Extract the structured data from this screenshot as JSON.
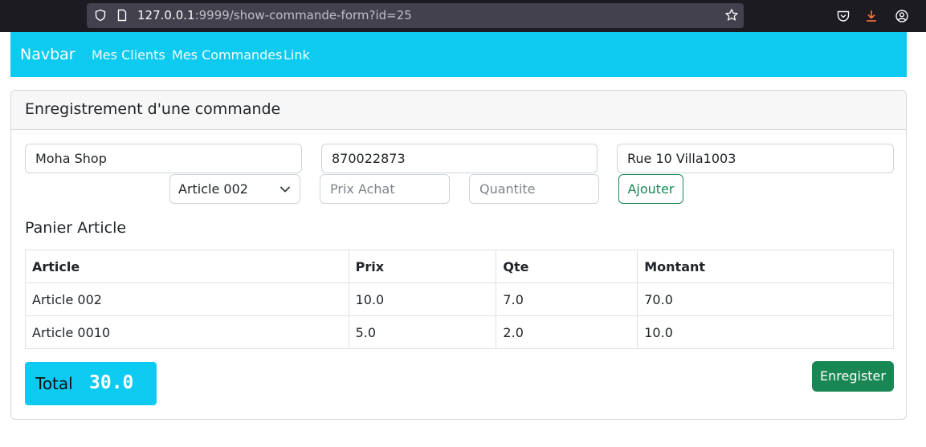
{
  "browser": {
    "url_host": "127.0.0.1",
    "url_rest": ":9999/show-commande-form?id=25",
    "icons": [
      "shield-icon",
      "page-icon",
      "star-icon",
      "pocket-icon",
      "download-icon",
      "account-icon"
    ],
    "download_color": "#ff7139"
  },
  "navbar": {
    "brand": "Navbar",
    "links": [
      "Mes Clients",
      "Mes Commandes",
      "Link"
    ],
    "color": "#0dcaf0"
  },
  "card": {
    "title": "Enregistrement d'une commande",
    "client_name": "Moha Shop",
    "client_phone": "870022873",
    "client_address": "Rue 10 Villa1003",
    "article_select": "Article 002",
    "prix_placeholder": "Prix Achat",
    "quantite_placeholder": "Quantite",
    "add_button": "Ajouter"
  },
  "panier": {
    "title": "Panier Article",
    "columns": [
      "Article",
      "Prix",
      "Qte",
      "Montant"
    ],
    "rows": [
      [
        "Article 002",
        "10.0",
        "7.0",
        "70.0"
      ],
      [
        "Article 0010",
        "5.0",
        "2.0",
        "10.0"
      ]
    ]
  },
  "total": {
    "label": "Total",
    "value": "30.0"
  },
  "save_button": "Enregister",
  "colors": {
    "success": "#198754",
    "info": "#0dcaf0"
  }
}
